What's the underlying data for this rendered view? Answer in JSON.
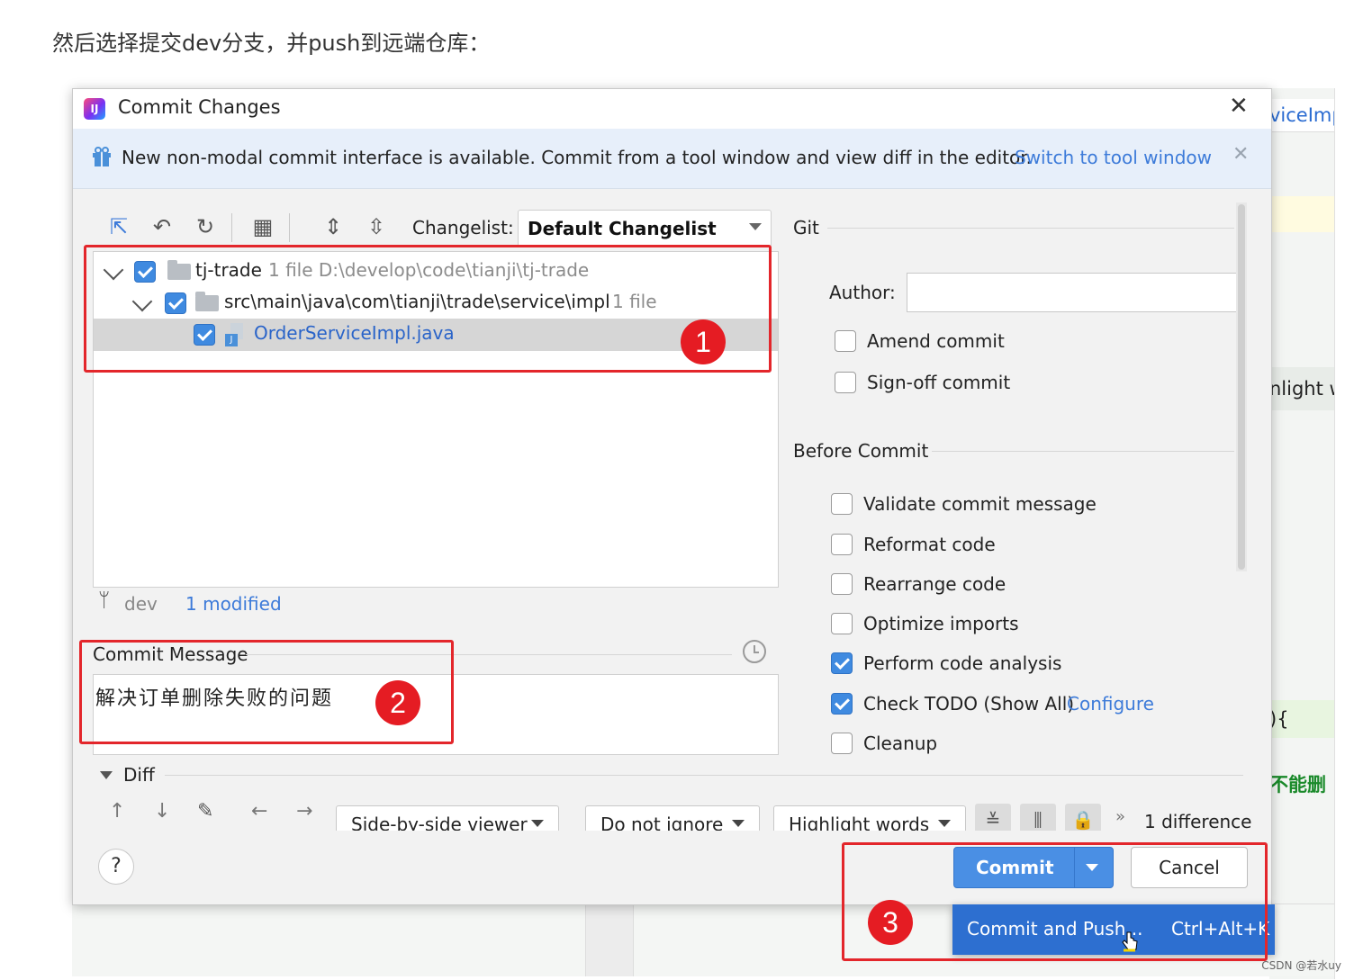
{
  "caption": "然后选择提交dev分支，并push到远端仓库：",
  "background": {
    "tab_text": "viceImp",
    "side_text": "nlight w",
    "code_text": "){",
    "zh_text": "不能删"
  },
  "watermark": "CSDN @若水uy",
  "dialog": {
    "title": "Commit Changes",
    "banner": {
      "text": "New non-modal commit interface is available. Commit from a tool window and view diff in the editor.",
      "link": "Switch to tool window"
    },
    "toolbar": {
      "changelist_label": "Changelist:",
      "changelist_value": "Default Changelist"
    },
    "tree": {
      "rows": [
        {
          "name": "tj-trade",
          "meta": "1 file  D:\\develop\\code\\tianji\\tj-trade"
        },
        {
          "name": "src\\main\\java\\com\\tianji\\trade\\service\\impl",
          "meta": "1 file"
        },
        {
          "name": "OrderServiceImpl.java",
          "meta": ""
        }
      ]
    },
    "status": {
      "branch": "dev",
      "modified": "1 modified"
    },
    "commit_message": {
      "label": "Commit Message",
      "value": "解决订单删除失败的问题"
    },
    "git": {
      "section": "Git",
      "author_label": "Author:",
      "author_value": "",
      "options": [
        {
          "label": "Amend commit",
          "checked": false
        },
        {
          "label": "Sign-off commit",
          "checked": false
        }
      ]
    },
    "before_commit": {
      "section": "Before Commit",
      "options": [
        {
          "label": "Validate commit message",
          "checked": false
        },
        {
          "label": "Reformat code",
          "checked": false
        },
        {
          "label": "Rearrange code",
          "checked": false
        },
        {
          "label": "Optimize imports",
          "checked": false
        },
        {
          "label": "Perform code analysis",
          "checked": true
        },
        {
          "label": "Check TODO (Show All)",
          "checked": true,
          "link": "Configure"
        },
        {
          "label": "Cleanup",
          "checked": false
        }
      ]
    },
    "diff": {
      "label": "Diff",
      "viewer": "Side-by-side viewer",
      "ignore": "Do not ignore",
      "highlight": "Highlight words",
      "count": "1 difference"
    },
    "buttons": {
      "help": "?",
      "commit": "Commit",
      "cancel": "Cancel"
    },
    "popup": {
      "item": "Commit and Push...",
      "shortcut": "Ctrl+Alt+K"
    }
  },
  "annotations": {
    "badge1": "1",
    "badge2": "2",
    "badge3": "3",
    "color": "#e3262b"
  },
  "colors": {
    "accent": "#4a8fe4",
    "link": "#3d7bd9",
    "popup": "#2d6fd0"
  }
}
